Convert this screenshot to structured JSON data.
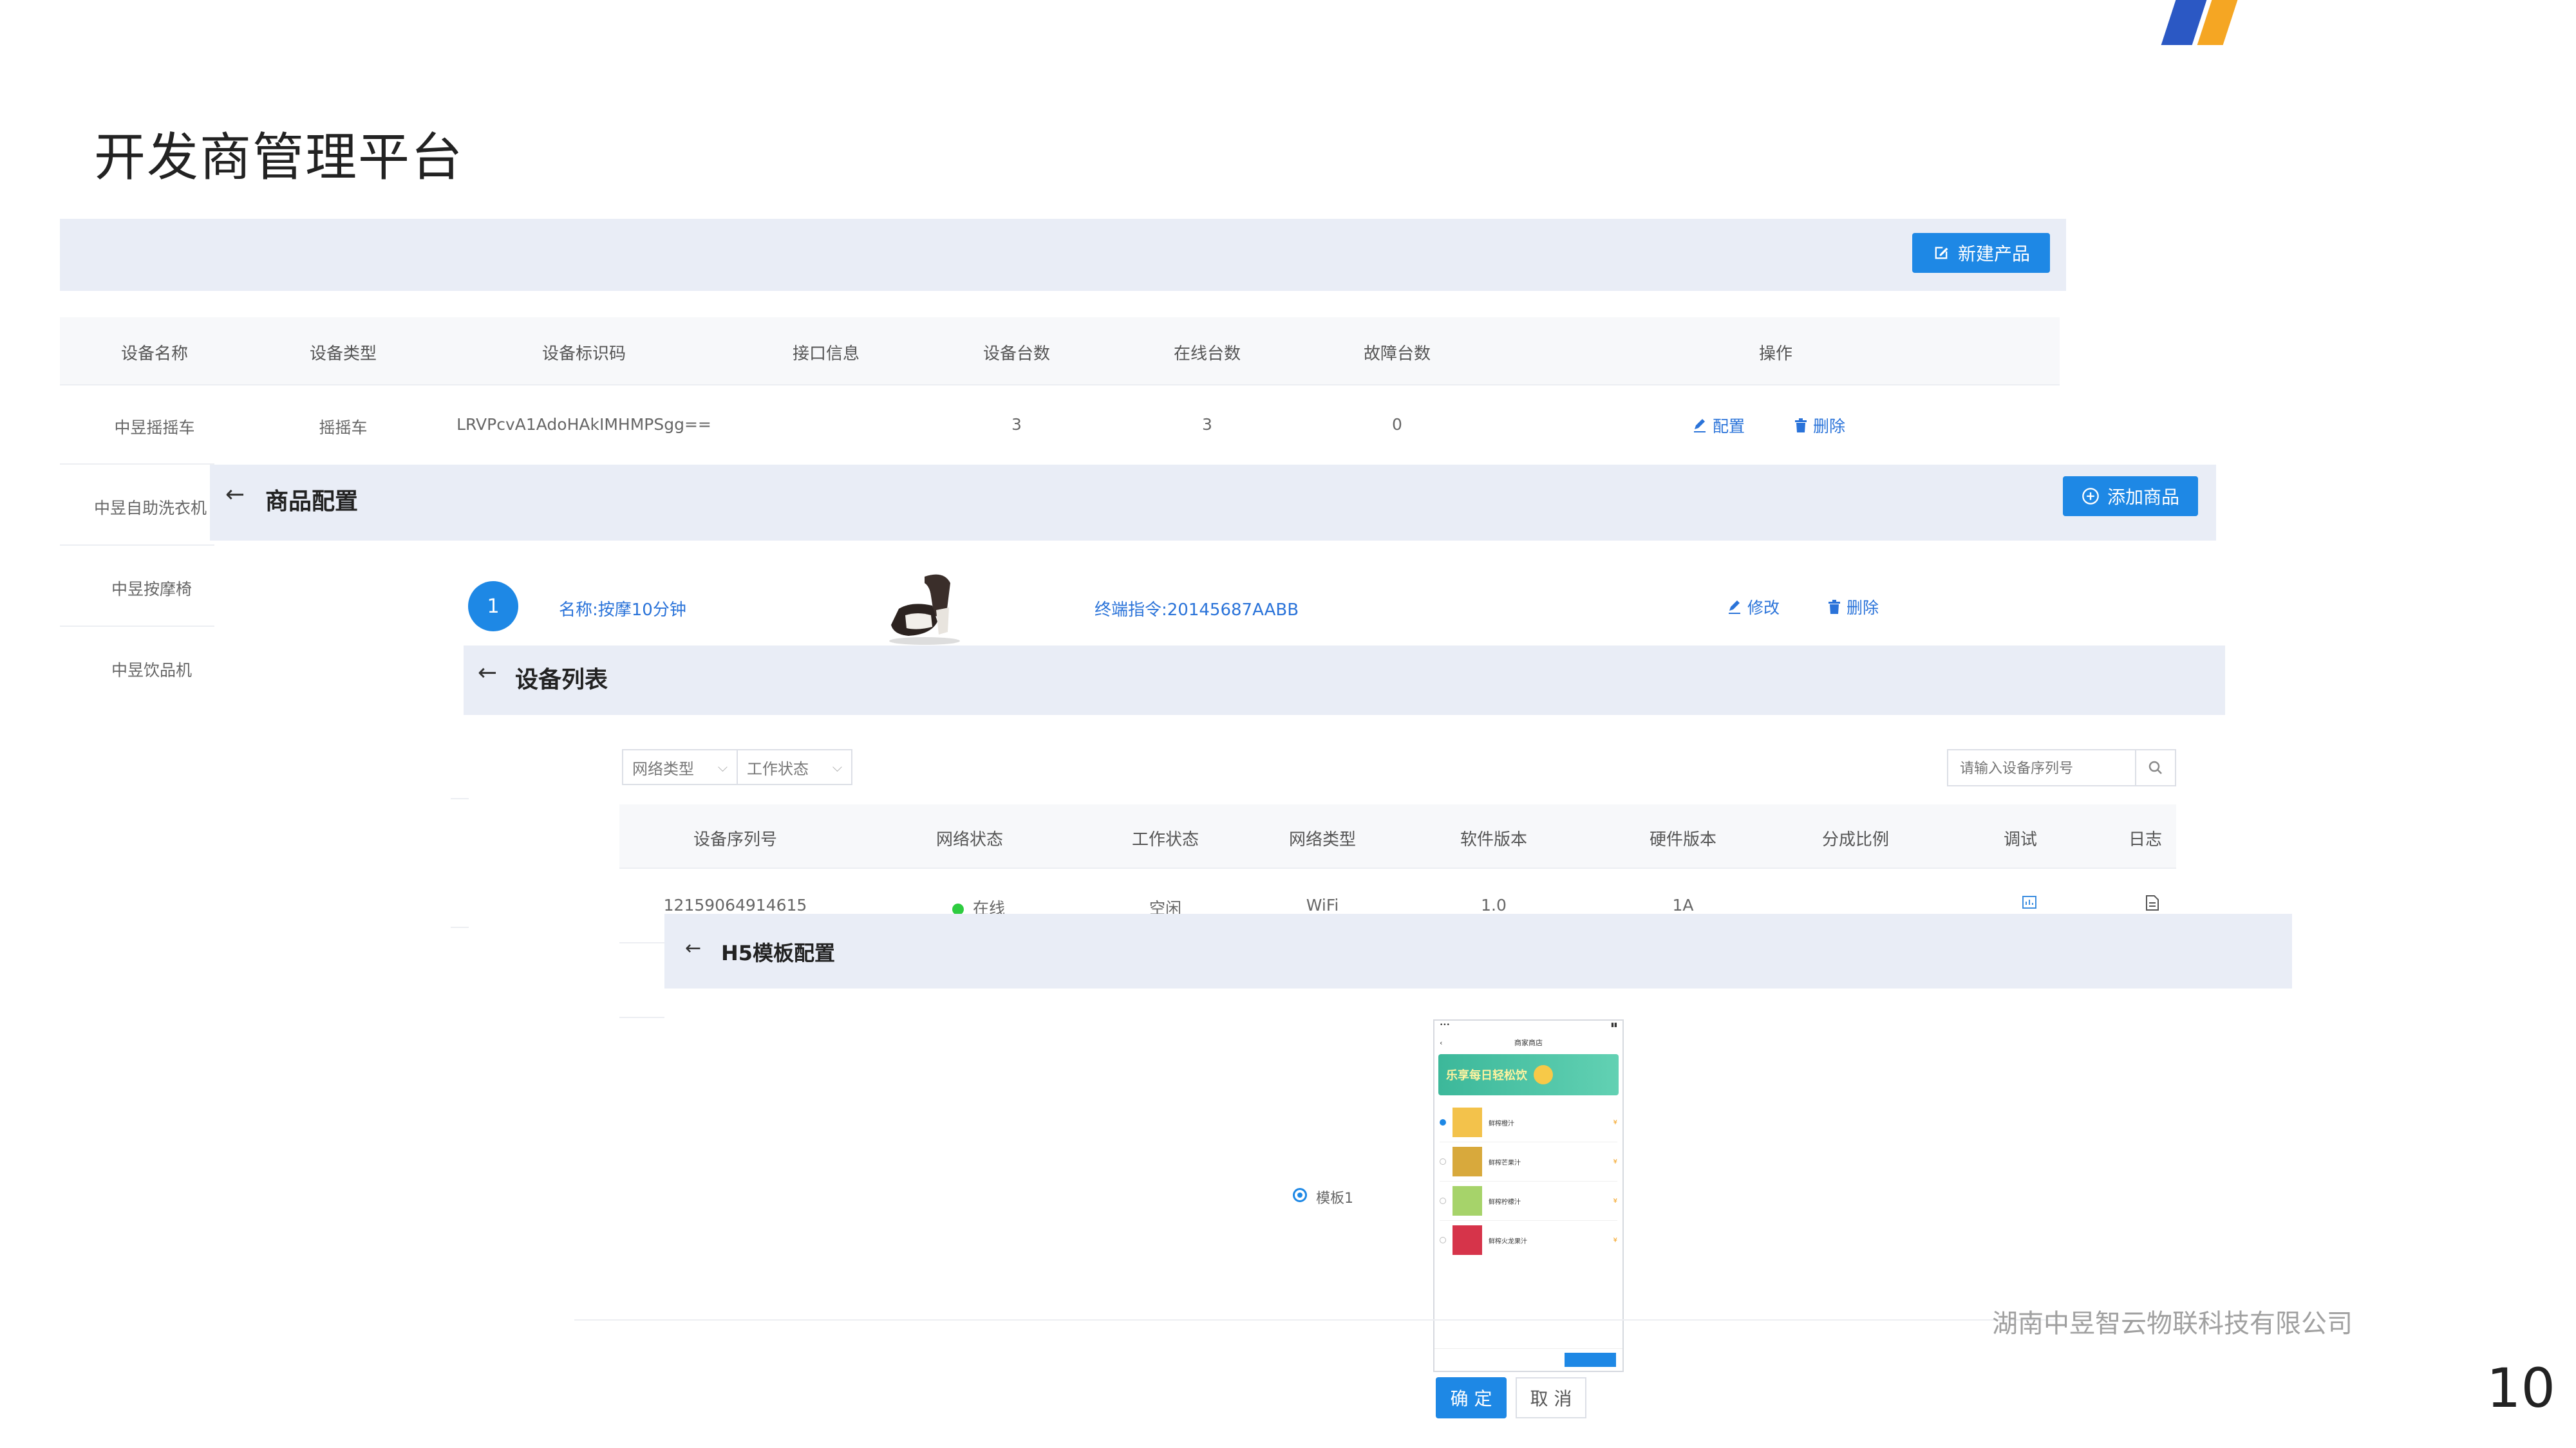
{
  "header": {
    "title": "开发商管理平台",
    "colors": {
      "accent": "#1e88e5",
      "bar_bg": "#e9edf6",
      "logo_blue": "#2b58c4",
      "logo_orange": "#f5a623"
    }
  },
  "product_list": {
    "new_button": "新建产品",
    "columns": [
      "设备名称",
      "设备类型",
      "设备标识码",
      "接口信息",
      "设备台数",
      "在线台数",
      "故障台数",
      "操作"
    ],
    "row": {
      "name": "中昱摇摇车",
      "type": "摇摇车",
      "id_code": "LRVPcvA1AdoHAkIMHMPSgg==",
      "count": "3",
      "online": "3",
      "fault": "0",
      "config": "配置",
      "delete": "删除"
    },
    "side_items": [
      "中昱自助洗衣机",
      "中昱按摩椅",
      "中昱饮品机"
    ]
  },
  "goods_config": {
    "title": "商品配置",
    "add_button": "添加商品",
    "item": {
      "index": "1",
      "name": "名称:按摩10分钟",
      "command": "终端指令:20145687AABB",
      "edit": "修改",
      "delete": "删除"
    }
  },
  "device_list": {
    "title": "设备列表",
    "filters": {
      "network_type": "网络类型",
      "work_status": "工作状态"
    },
    "search_placeholder": "请输入设备序列号",
    "columns": [
      "设备序列号",
      "网络状态",
      "工作状态",
      "网络类型",
      "软件版本",
      "硬件版本",
      "分成比例",
      "调试",
      "日志"
    ],
    "row": {
      "serial": "12159064914615",
      "net_status": "在线",
      "work_status": "空闲",
      "net_type": "WiFi",
      "software": "1.0",
      "hardware": "1A"
    }
  },
  "h5_config": {
    "title": "H5模板配置",
    "template_label": "模板1",
    "phone_title": "商家商店",
    "banner_text": "乐享每日轻松饮",
    "products": [
      "鲜榨橙汁",
      "鲜榨芒果汁",
      "鲜榨柠檬汁",
      "鲜榨火龙果汁"
    ],
    "confirm": "确 定",
    "cancel": "取 消"
  },
  "footer": {
    "company": "湖南中昱智云物联科技有限公司",
    "page_number": "10"
  }
}
